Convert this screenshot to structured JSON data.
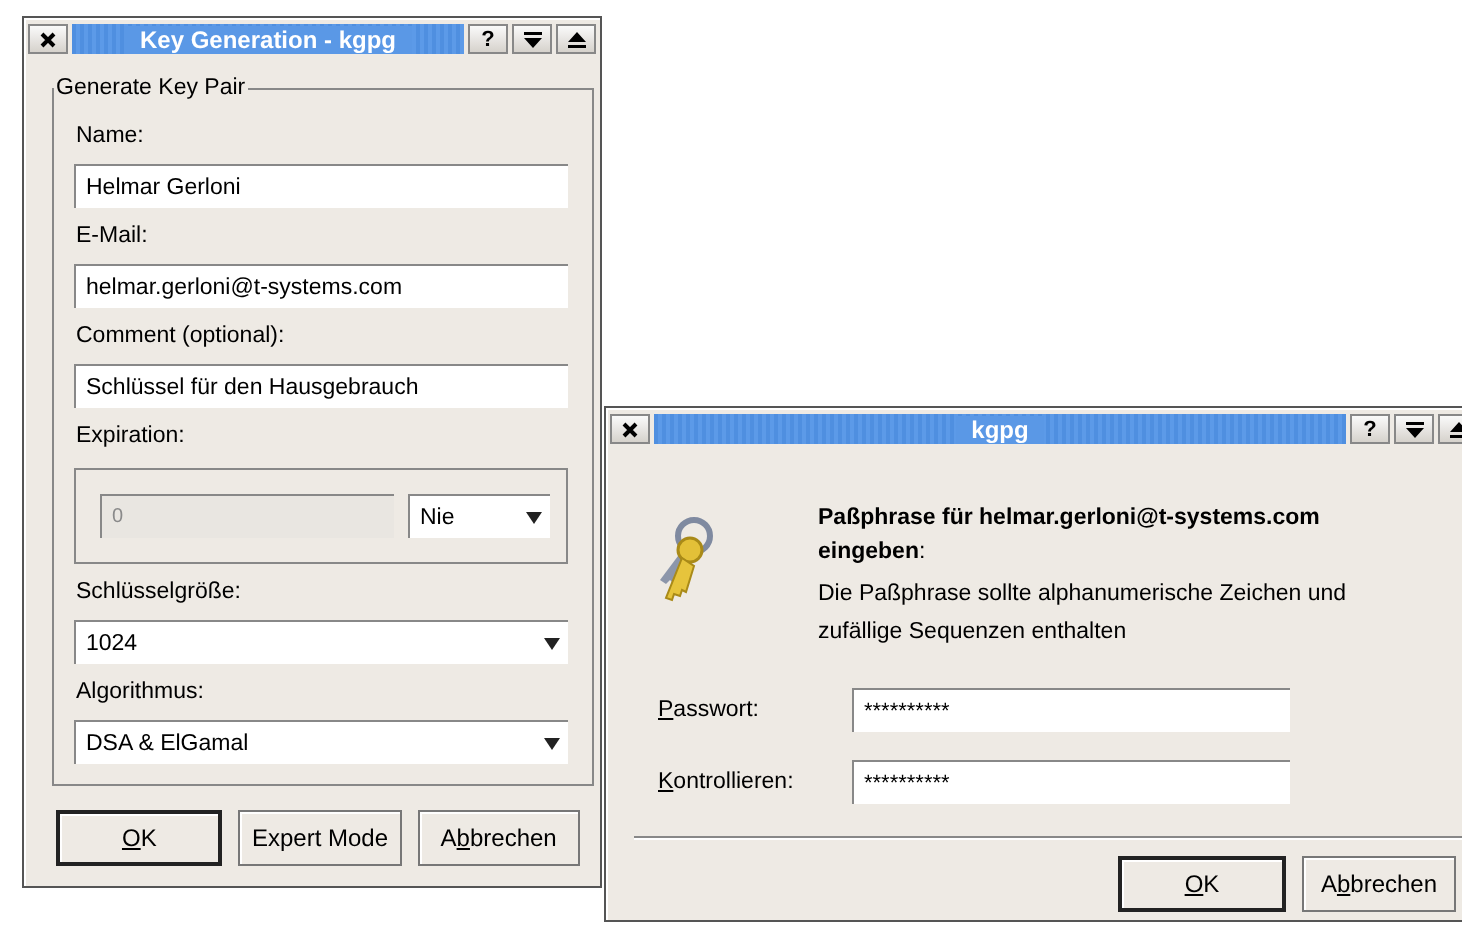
{
  "windows": [
    {
      "title": "Key Generation - kgpg",
      "help_label": "?",
      "active": true,
      "group": {
        "title": "Generate Key Pair",
        "fields": [
          {
            "kind": "text",
            "label": "Name:",
            "value": "Helmar Gerloni"
          },
          {
            "kind": "text",
            "label": "E-Mail:",
            "value": "helmar.gerloni@t-systems.com"
          },
          {
            "kind": "text",
            "label": "Comment (optional):",
            "value": "Schlüssel für den Hausgebrauch"
          },
          {
            "kind": "expiration",
            "label": "Expiration:",
            "value": "0",
            "disabled": true,
            "unit": "Nie"
          },
          {
            "kind": "combo",
            "label": "Schlüsselgröße:",
            "value": "1024"
          },
          {
            "kind": "combo",
            "label": "Algorithmus:",
            "value": "DSA & ElGamal"
          }
        ]
      },
      "buttons": [
        {
          "label": [
            {
              "text": "O",
              "underlined": true
            },
            {
              "text": "K",
              "underlined": false
            }
          ],
          "default": true
        },
        {
          "label": [
            {
              "text": "Expert Mode",
              "underlined": false
            }
          ],
          "default": false
        },
        {
          "label": [
            {
              "text": "A",
              "underlined": false
            },
            {
              "text": "b",
              "underlined": true
            },
            {
              "text": "brechen",
              "underlined": false
            }
          ],
          "default": false
        }
      ]
    },
    {
      "title": "kgpg",
      "help_label": "?",
      "active": true,
      "heading": "**Paßphrase für helmar.gerloni@t-systems.com eingeben**:",
      "description": "Die Paßphrase sollte alphanumerische Zeichen und zufällige Sequenzen enthalten",
      "fields": [
        {
          "label": [
            {
              "text": "P",
              "underlined": true
            },
            {
              "text": "asswort:",
              "underlined": false
            }
          ],
          "value": "**********"
        },
        {
          "label": [
            {
              "text": "K",
              "underlined": true
            },
            {
              "text": "ontrollieren:",
              "underlined": false
            }
          ],
          "value": "**********"
        }
      ],
      "buttons": [
        {
          "label": [
            {
              "text": "O",
              "underlined": true
            },
            {
              "text": "K",
              "underlined": false
            }
          ],
          "default": true
        },
        {
          "label": [
            {
              "text": "A",
              "underlined": false
            },
            {
              "text": "b",
              "underlined": true
            },
            {
              "text": "brechen",
              "underlined": false
            }
          ],
          "default": false
        }
      ]
    }
  ]
}
